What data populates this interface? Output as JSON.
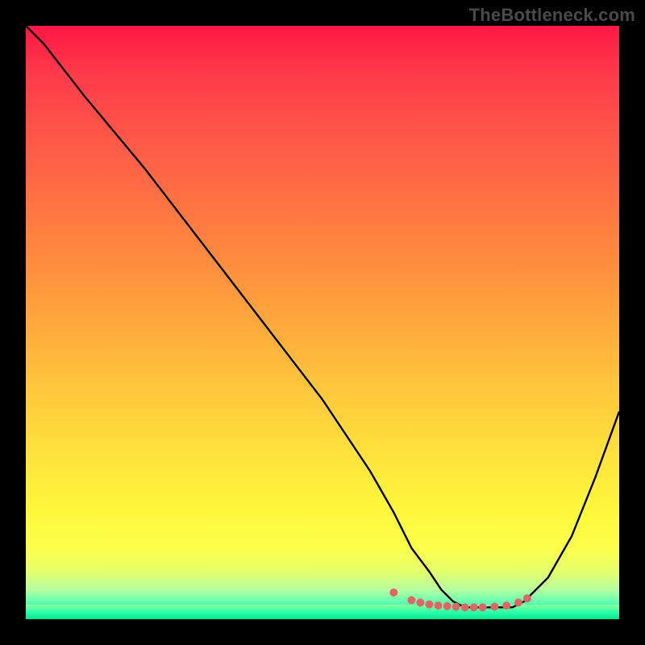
{
  "watermark": "TheBottleneck.com",
  "colors": {
    "curve": "#000000",
    "markers": "#e06666",
    "bg_black": "#000000"
  },
  "chart_data": {
    "type": "line",
    "title": "",
    "xlabel": "",
    "ylabel": "",
    "xlim": [
      0,
      100
    ],
    "ylim": [
      0,
      100
    ],
    "x": [
      0,
      3,
      10,
      20,
      30,
      40,
      50,
      58,
      62,
      65,
      68,
      70,
      72,
      74,
      76,
      78,
      80,
      82,
      84,
      88,
      92,
      96,
      100
    ],
    "y": [
      100,
      97,
      88,
      76,
      63,
      50,
      37,
      25,
      18,
      12,
      8,
      5,
      3,
      2,
      2,
      2,
      2,
      2,
      3,
      7,
      14,
      24,
      35
    ],
    "markers": {
      "x": [
        62,
        65,
        66.5,
        68,
        69.5,
        71,
        72.5,
        74,
        75.5,
        77,
        79,
        81,
        83,
        84.5
      ],
      "y": [
        4.5,
        3.2,
        2.8,
        2.5,
        2.3,
        2.2,
        2.1,
        2.0,
        2.0,
        2.0,
        2.1,
        2.3,
        2.8,
        3.5
      ]
    },
    "legend": false,
    "grid": false
  }
}
